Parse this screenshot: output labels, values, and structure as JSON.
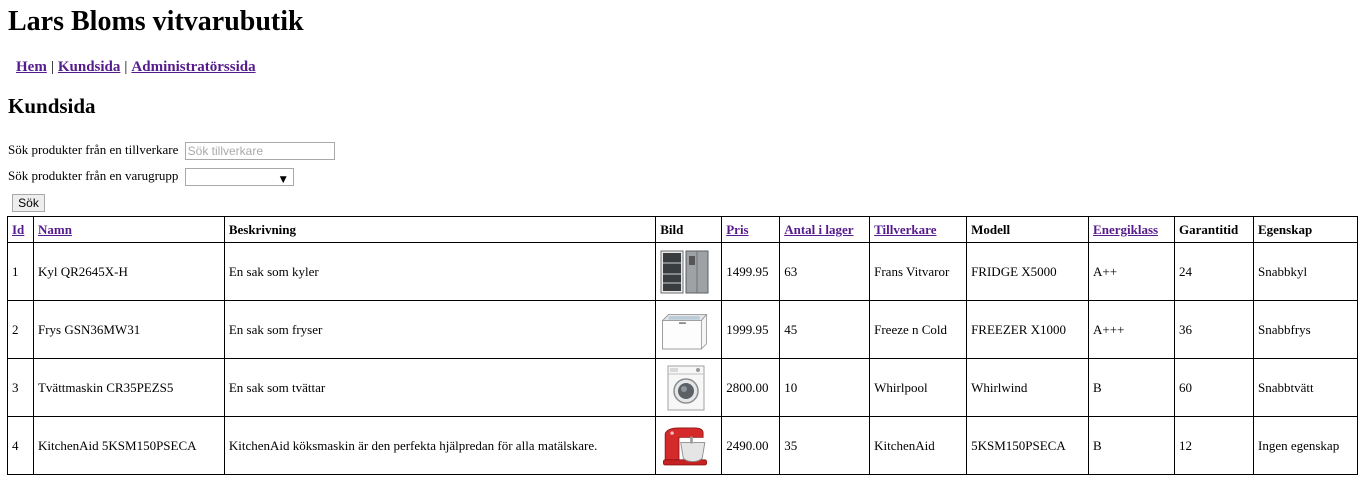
{
  "page": {
    "title": "Lars Bloms vitvarubutik",
    "heading": "Kundsida"
  },
  "nav": {
    "items": [
      "Hem",
      "Kundsida",
      "Administratörssida"
    ],
    "separator": "|"
  },
  "search": {
    "manufacturer_label": "Sök produkter från en tillverkare",
    "manufacturer_placeholder": "Sök tillverkare",
    "manufacturer_value": "",
    "group_label": "Sök produkter från en varugrupp",
    "group_selected": "",
    "button_label": "Sök"
  },
  "table": {
    "headers": {
      "id": "Id",
      "name": "Namn",
      "description": "Beskrivning",
      "image": "Bild",
      "price": "Pris",
      "stock": "Antal i lager",
      "manufacturer": "Tillverkare",
      "model": "Modell",
      "energy": "Energiklass",
      "warranty": "Garantitid",
      "feature": "Egenskap"
    },
    "rows": [
      {
        "id": "1",
        "name": "Kyl QR2645X-H",
        "description": "En sak som kyler",
        "image": "fridge-image",
        "price": "1499.95",
        "stock": "63",
        "manufacturer": "Frans Vitvaror",
        "model": "FRIDGE X5000",
        "energy": "A++",
        "warranty": "24",
        "feature": "Snabbkyl"
      },
      {
        "id": "2",
        "name": "Frys GSN36MW31",
        "description": "En sak som fryser",
        "image": "freezer-image",
        "price": "1999.95",
        "stock": "45",
        "manufacturer": "Freeze n Cold",
        "model": "FREEZER X1000",
        "energy": "A+++",
        "warranty": "36",
        "feature": "Snabbfrys"
      },
      {
        "id": "3",
        "name": "Tvättmaskin CR35PEZS5",
        "description": "En sak som tvättar",
        "image": "washer-image",
        "price": "2800.00",
        "stock": "10",
        "manufacturer": "Whirlpool",
        "model": "Whirlwind",
        "energy": "B",
        "warranty": "60",
        "feature": "Snabbtvätt"
      },
      {
        "id": "4",
        "name": "KitchenAid 5KSM150PSECA",
        "description": "KitchenAid köksmaskin är den perfekta hjälpredan för alla matälskare.",
        "image": "mixer-image",
        "price": "2490.00",
        "stock": "35",
        "manufacturer": "KitchenAid",
        "model": "5KSM150PSECA",
        "energy": "B",
        "warranty": "12",
        "feature": "Ingen egenskap"
      }
    ]
  },
  "colors": {
    "link": "#551a8b",
    "mixer_red": "#d42a2a"
  }
}
